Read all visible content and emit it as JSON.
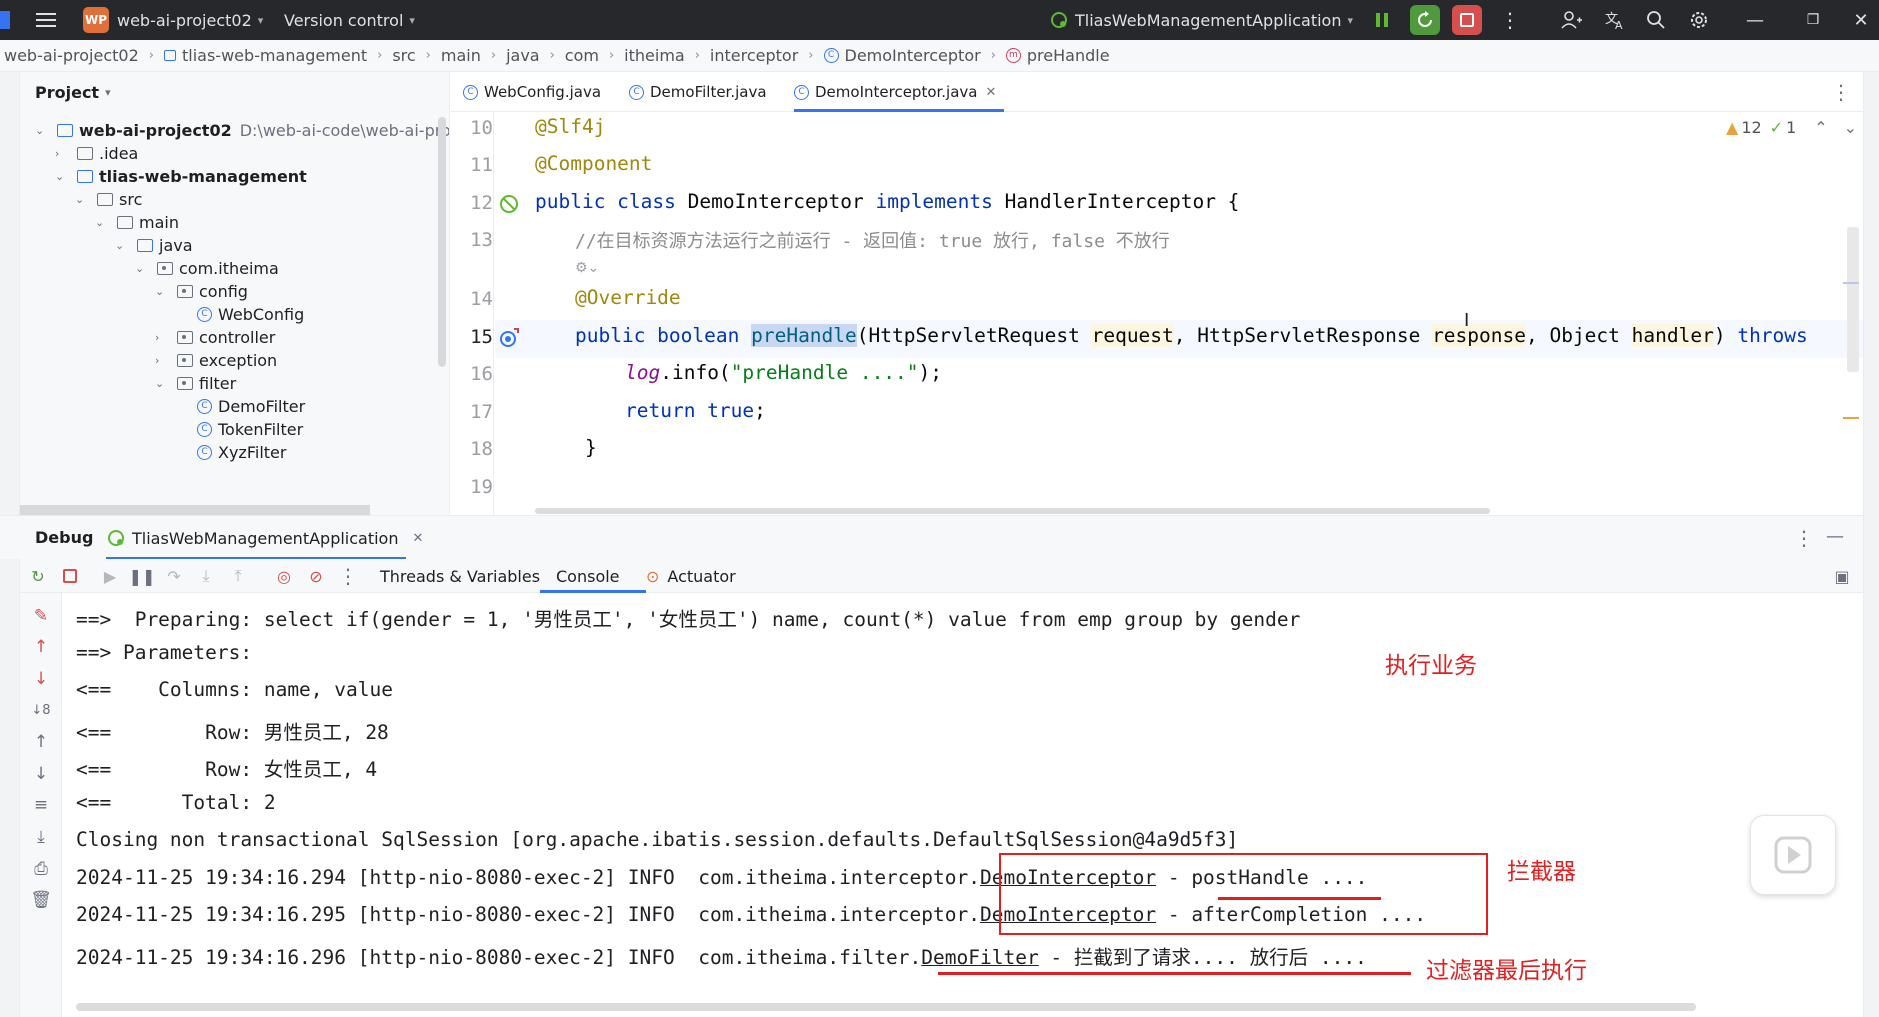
{
  "titlebar": {
    "project_badge": "WP",
    "project_name": "web-ai-project02",
    "vcs_label": "Version control",
    "run_config": "TliasWebManagementApplication"
  },
  "breadcrumb": [
    "web-ai-project02",
    "tlias-web-management",
    "src",
    "main",
    "java",
    "com",
    "itheima",
    "interceptor",
    "DemoInterceptor",
    "preHandle"
  ],
  "project_panel": {
    "title": "Project",
    "root_name": "web-ai-project02",
    "root_path": "D:\\web-ai-code\\web-ai-proj",
    "items": [
      {
        "label": ".idea"
      },
      {
        "label": "tlias-web-management"
      },
      {
        "label": "src"
      },
      {
        "label": "main"
      },
      {
        "label": "java"
      },
      {
        "label": "com.itheima"
      },
      {
        "label": "config"
      },
      {
        "label": "WebConfig"
      },
      {
        "label": "controller"
      },
      {
        "label": "exception"
      },
      {
        "label": "filter"
      },
      {
        "label": "DemoFilter"
      },
      {
        "label": "TokenFilter"
      },
      {
        "label": "XyzFilter"
      }
    ]
  },
  "editor": {
    "tabs": [
      "WebConfig.java",
      "DemoFilter.java",
      "DemoInterceptor.java"
    ],
    "warnings": "12",
    "checks": "1",
    "line_numbers": [
      "10",
      "11",
      "12",
      "13",
      "14",
      "15",
      "16",
      "17",
      "18",
      "19"
    ],
    "lines": {
      "l10": "@Slf4j",
      "l11": "@Component",
      "l12_kw1": "public class ",
      "l12_name": "DemoInterceptor ",
      "l12_kw2": "implements ",
      "l12_rest": "HandlerInterceptor {",
      "l13": "//在目标资源方法运行之前运行 - 返回值: true 放行, false 不放行",
      "l14": "@Override",
      "l15_kw": "public boolean ",
      "l15_method": "preHandle",
      "l15_a": "(HttpServletRequest ",
      "l15_p1": "request",
      "l15_b": ", HttpServletResponse ",
      "l15_p2": "response",
      "l15_c": ", Object ",
      "l15_p3": "handler",
      "l15_d": ") ",
      "l15_throws": "throws",
      "l16_log": "log",
      "l16_a": ".info(",
      "l16_str": "\"preHandle ....\"",
      "l16_b": ");",
      "l17_kw": "return true",
      "l17_b": ";",
      "l18": "}"
    }
  },
  "debug": {
    "title": "Debug",
    "session_tab": "TliasWebManagementApplication",
    "tabs": [
      "Threads & Variables",
      "Console",
      "Actuator"
    ]
  },
  "console": {
    "lines": [
      "==>  Preparing: select if(gender = 1, '男性员工', '女性员工') name, count(*) value from emp group by gender",
      "==> Parameters: ",
      "<==    Columns: name, value",
      "<==        Row: 男性员工, 28",
      "<==        Row: 女性员工, 4",
      "<==      Total: 2",
      "Closing non transactional SqlSession [org.apache.ibatis.session.defaults.DefaultSqlSession@4a9d5f3]"
    ],
    "log1_prefix": "2024-11-25 19:34:16.294 [http-nio-8080-exec-2] INFO  com.itheima.interceptor.",
    "log1_class": "DemoInterceptor",
    "log1_msg": " - postHandle ....",
    "log2_prefix": "2024-11-25 19:34:16.295 [http-nio-8080-exec-2] INFO  com.itheima.interceptor.",
    "log2_class": "DemoInterceptor",
    "log2_msg": " - afterCompletion ....",
    "log3_prefix": "2024-11-25 19:34:16.296 [http-nio-8080-exec-2] INFO  com.itheima.filter.",
    "log3_class": "DemoFilter",
    "log3_msg": " - 拦截到了请求.... 放行后 ...."
  },
  "annotations": {
    "business": "执行业务",
    "interceptor": "拦截器",
    "filter_last": "过滤器最后执行"
  },
  "colors": {
    "annotation_red": "#e02020",
    "accent_blue": "#3574f0",
    "titlebar_bg": "#27282c"
  }
}
